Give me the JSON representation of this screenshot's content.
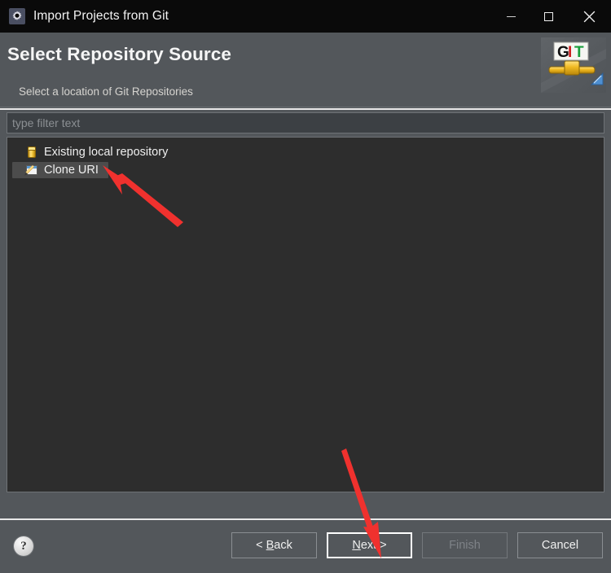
{
  "window": {
    "title": "Import Projects from Git",
    "app_icon": "eclipse-gear-icon",
    "controls": {
      "minimize": "minimize-icon",
      "maximize": "maximize-icon",
      "close": "close-icon"
    }
  },
  "header": {
    "title": "Select Repository Source",
    "subtitle": "Select a location of Git Repositories",
    "logo": {
      "name": "git-banner-logo",
      "letters": [
        {
          "char": "G",
          "color": "#111111"
        },
        {
          "char": "I",
          "color": "#cc2222"
        },
        {
          "char": "T",
          "color": "#1a9e3c"
        }
      ]
    }
  },
  "filter": {
    "placeholder": "type filter text",
    "value": ""
  },
  "tree": {
    "items": [
      {
        "label": "Existing local repository",
        "icon": "repository-cylinder-icon",
        "selected": false
      },
      {
        "label": "Clone URI",
        "icon": "clone-uri-pencil-icon",
        "selected": true
      }
    ]
  },
  "footer": {
    "help": {
      "label": "?",
      "name": "help-icon"
    },
    "buttons": [
      {
        "label": "< Back",
        "mnemonic": "B",
        "state": "enabled",
        "name": "back-button"
      },
      {
        "label": "Next >",
        "mnemonic": "N",
        "state": "focused",
        "name": "next-button"
      },
      {
        "label": "Finish",
        "mnemonic": "",
        "state": "disabled",
        "name": "finish-button"
      },
      {
        "label": "Cancel",
        "mnemonic": "",
        "state": "enabled",
        "name": "cancel-button"
      }
    ]
  },
  "annotations": {
    "color": "#f0312e",
    "arrows": [
      {
        "name": "arrow-to-clone-uri",
        "points_to": "Clone URI"
      },
      {
        "name": "arrow-to-next-button",
        "points_to": "Next >"
      }
    ]
  },
  "colors": {
    "titlebar_bg": "#0a0a0a",
    "dialog_bg": "#53575b",
    "tree_bg": "#2d2d2d",
    "selection_bg": "#4c4c4c",
    "text": "#f0f0f0",
    "accent_red": "#f0312e"
  }
}
